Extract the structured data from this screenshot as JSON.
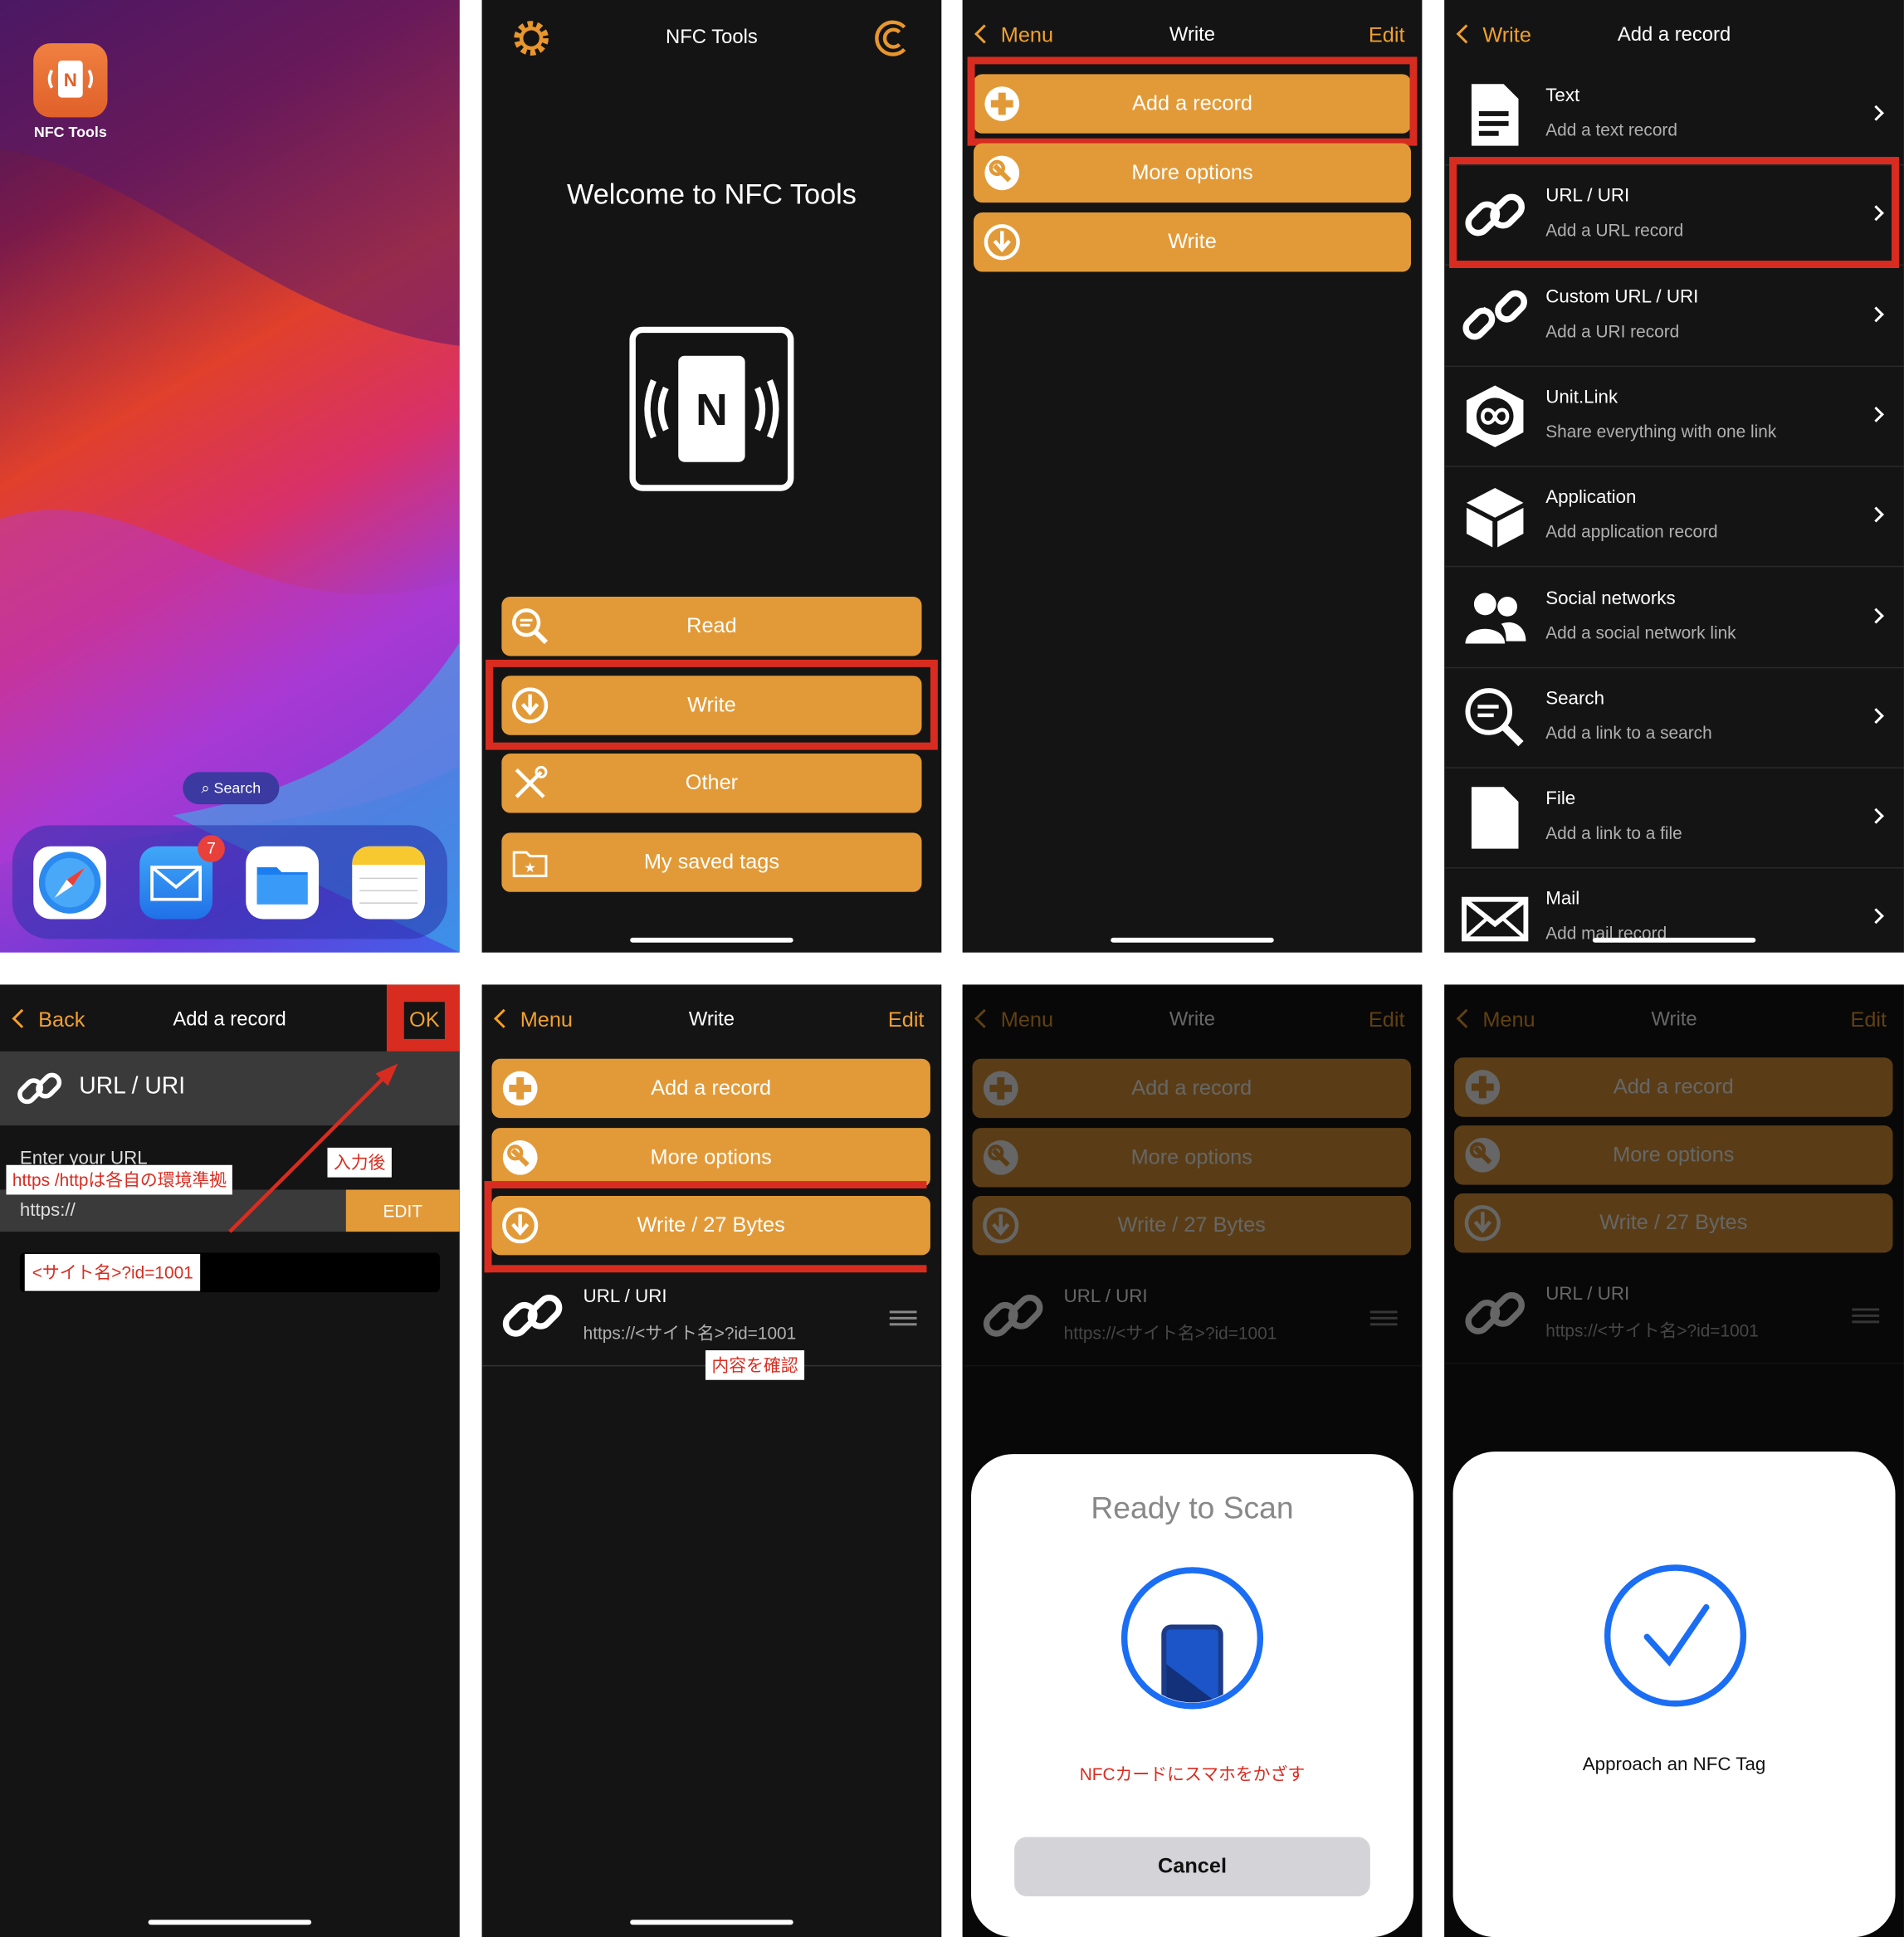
{
  "home": {
    "app_name": "NFC Tools",
    "search_label": "Search",
    "mail_badge": "7"
  },
  "main_menu": {
    "title": "NFC Tools",
    "welcome": "Welcome to NFC Tools",
    "buttons": [
      "Read",
      "Write",
      "Other",
      "My saved tags"
    ]
  },
  "write_screen": {
    "back": "Menu",
    "title": "Write",
    "edit": "Edit",
    "buttons": [
      "Add a record",
      "More options",
      "Write"
    ]
  },
  "add_record": {
    "back": "Write",
    "title": "Add a record",
    "items": [
      {
        "title": "Text",
        "sub": "Add a text record"
      },
      {
        "title": "URL / URI",
        "sub": "Add a URL record"
      },
      {
        "title": "Custom URL / URI",
        "sub": "Add a URI record"
      },
      {
        "title": "Unit.Link",
        "sub": "Share everything with one link"
      },
      {
        "title": "Application",
        "sub": "Add application record"
      },
      {
        "title": "Social networks",
        "sub": "Add a social network link"
      },
      {
        "title": "Search",
        "sub": "Add a link to a search"
      },
      {
        "title": "File",
        "sub": "Add a link to a file"
      },
      {
        "title": "Mail",
        "sub": "Add mail record"
      }
    ]
  },
  "url_entry": {
    "back": "Back",
    "title": "Add a record",
    "ok": "OK",
    "record_type": "URL / URI",
    "field_label": "Enter your URL",
    "scheme": "https://",
    "edit_button": "EDIT",
    "annotation_scheme": "https /httpは各自の環境準拠",
    "annotation_after": "入力後",
    "annotation_value": "<サイト名>?id=1001"
  },
  "write_ready": {
    "back": "Menu",
    "title": "Write",
    "edit": "Edit",
    "buttons": [
      "Add a record",
      "More options",
      "Write / 27 Bytes"
    ],
    "record_title": "URL / URI",
    "record_value": "https://<サイト名>?id=1001",
    "annotation_confirm": "内容を確認"
  },
  "scan_sheet": {
    "title": "Ready to Scan",
    "instruction": "NFCカードにスマホをかざす",
    "cancel": "Cancel"
  },
  "done_sheet": {
    "message": "Approach an NFC Tag"
  },
  "colors": {
    "accent": "#e29a38",
    "highlight": "#d92c20",
    "ios_blue": "#1b6ef3",
    "background": "#141414"
  }
}
